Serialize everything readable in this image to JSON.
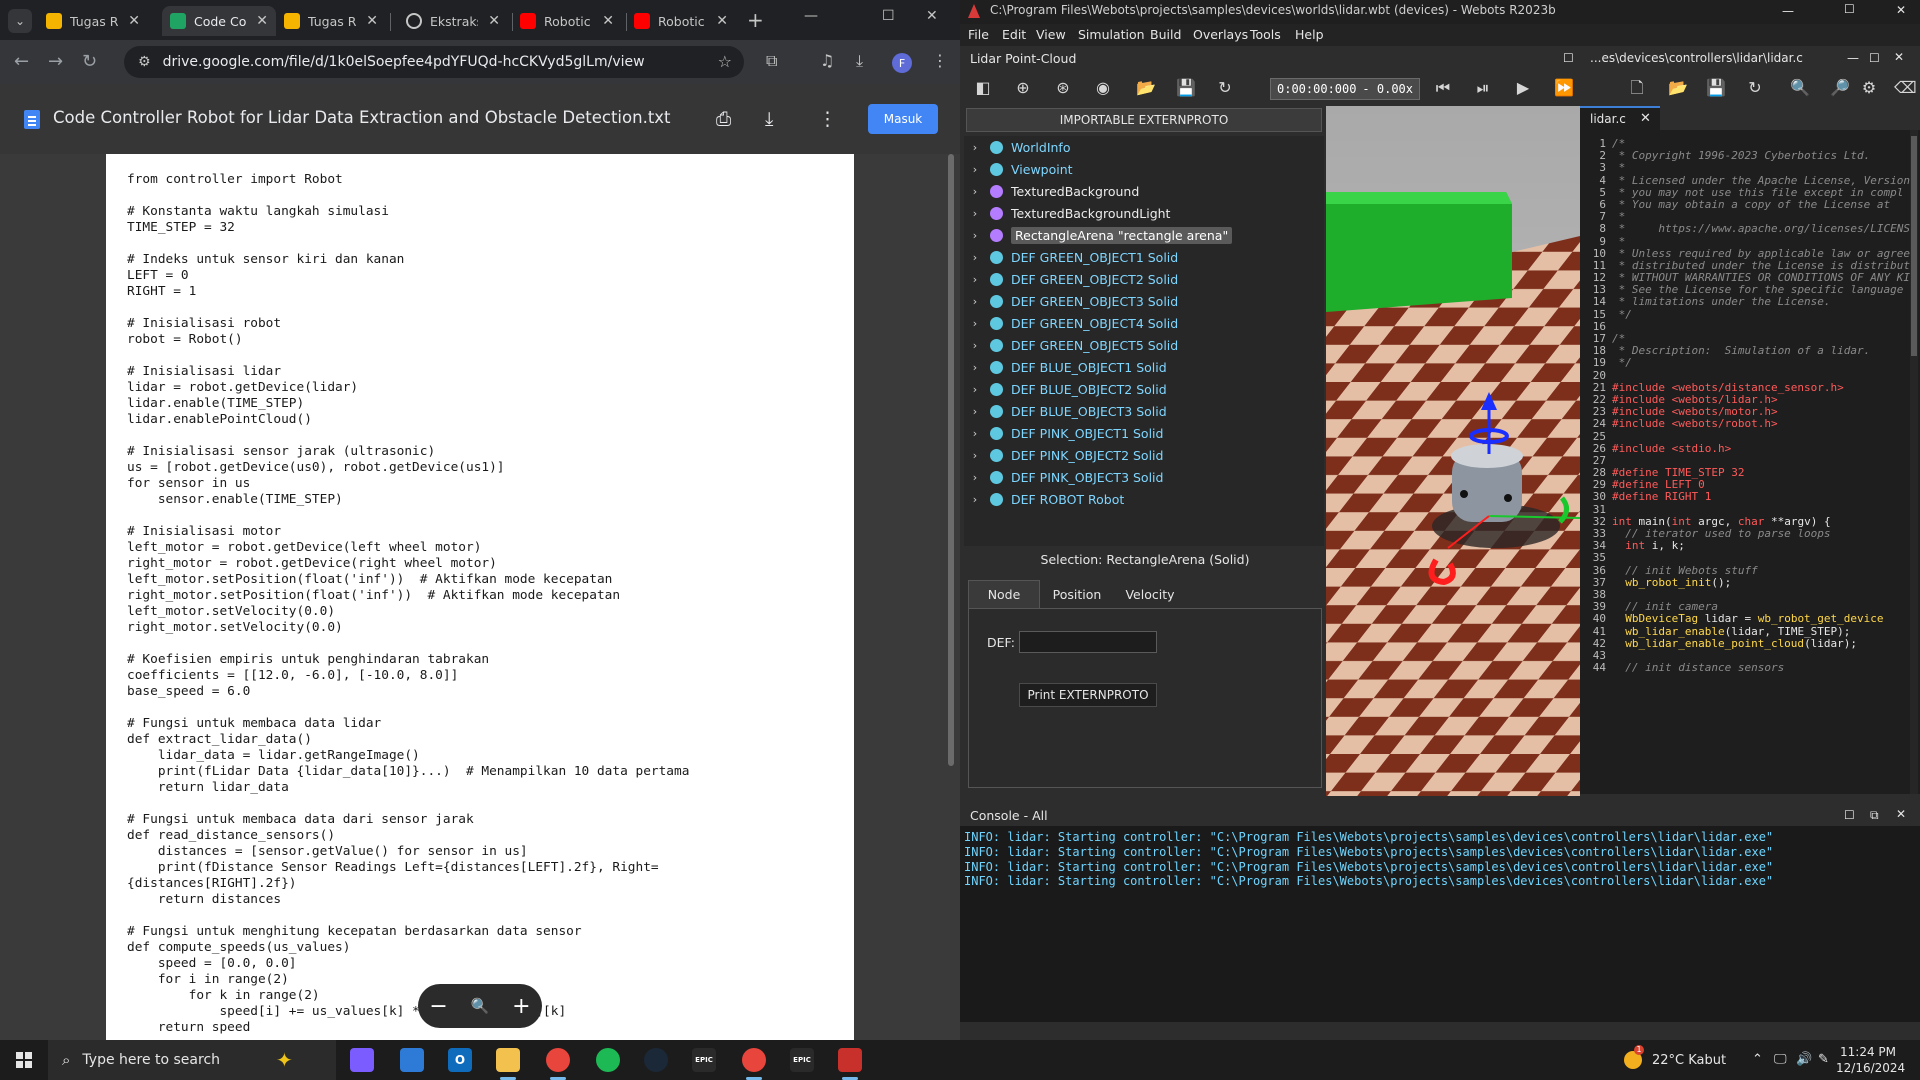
{
  "chrome": {
    "tabs": [
      {
        "title": "Tugas R",
        "icon": "google-slides-icon",
        "active": false
      },
      {
        "title": "Code Co",
        "icon": "google-drive-icon",
        "active": true
      },
      {
        "title": "Tugas R",
        "icon": "google-slides-icon",
        "active": false
      },
      {
        "title": "Ekstraksi",
        "icon": "openai-icon",
        "active": false
      },
      {
        "title": "Robotic",
        "icon": "youtube-icon",
        "active": false
      },
      {
        "title": "Robotic",
        "icon": "youtube-icon",
        "active": false
      }
    ],
    "url": "drive.google.com/file/d/1k0elSoepfee4pdYFUQd-hcCKVyd5glLm/view",
    "profile_initial": "F"
  },
  "drive": {
    "file_title": "Code Controller Robot for Lidar Data Extraction and Obstacle Detection.txt",
    "signin_label": "Masuk",
    "code_lines": [
      "from controller import Robot",
      "",
      "# Konstanta waktu langkah simulasi",
      "TIME_STEP = 32",
      "",
      "# Indeks untuk sensor kiri dan kanan",
      "LEFT = 0",
      "RIGHT = 1",
      "",
      "# Inisialisasi robot",
      "robot = Robot()",
      "",
      "# Inisialisasi lidar",
      "lidar = robot.getDevice(lidar)",
      "lidar.enable(TIME_STEP)",
      "lidar.enablePointCloud()",
      "",
      "# Inisialisasi sensor jarak (ultrasonic)",
      "us = [robot.getDevice(us0), robot.getDevice(us1)]",
      "for sensor in us",
      "    sensor.enable(TIME_STEP)",
      "",
      "# Inisialisasi motor",
      "left_motor = robot.getDevice(left wheel motor)",
      "right_motor = robot.getDevice(right wheel motor)",
      "left_motor.setPosition(float('inf'))  # Aktifkan mode kecepatan",
      "right_motor.setPosition(float('inf'))  # Aktifkan mode kecepatan",
      "left_motor.setVelocity(0.0)",
      "right_motor.setVelocity(0.0)",
      "",
      "# Koefisien empiris untuk penghindaran tabrakan",
      "coefficients = [[12.0, -6.0], [-10.0, 8.0]]",
      "base_speed = 6.0",
      "",
      "# Fungsi untuk membaca data lidar",
      "def extract_lidar_data()",
      "    lidar_data = lidar.getRangeImage()",
      "    print(fLidar Data {lidar_data[10]}...)  # Menampilkan 10 data pertama",
      "    return lidar_data",
      "",
      "# Fungsi untuk membaca data dari sensor jarak",
      "def read_distance_sensors()",
      "    distances = [sensor.getValue() for sensor in us]",
      "    print(fDistance Sensor Readings Left={distances[LEFT].2f}, Right=",
      "{distances[RIGHT].2f})",
      "    return distances",
      "",
      "# Fungsi untuk menghitung kecepatan berdasarkan data sensor",
      "def compute_speeds(us_values)",
      "    speed = [0.0, 0.0]",
      "    for i in range(2)",
      "        for k in range(2)",
      "            speed[i] += us_values[k] * coefficients[i][k]",
      "    return speed"
    ]
  },
  "webots": {
    "window_title": "C:\\Program Files\\Webots\\projects\\samples\\devices\\worlds\\lidar.wbt (devices) - Webots R2023b",
    "menu": [
      "File",
      "Edit",
      "View",
      "Simulation",
      "Build",
      "Overlays",
      "Tools",
      "Help"
    ],
    "scene_panel_title": "Lidar Point-Cloud",
    "sim_time": "0:00:00:000",
    "sim_speed": "- 0.00x",
    "extern_button": "IMPORTABLE EXTERNPROTO",
    "tree": [
      {
        "label": "WorldInfo",
        "color": "#5ec8e0",
        "style": "node"
      },
      {
        "label": "Viewpoint",
        "color": "#5ec8e0",
        "style": "node"
      },
      {
        "label": "TexturedBackground",
        "color": "#b47cff",
        "style": "proto"
      },
      {
        "label": "TexturedBackgroundLight",
        "color": "#b47cff",
        "style": "proto"
      },
      {
        "label": "RectangleArena \"rectangle arena\"",
        "color": "#b47cff",
        "style": "selected"
      },
      {
        "label": "DEF GREEN_OBJECT1 Solid",
        "color": "#5ec8e0",
        "style": "node"
      },
      {
        "label": "DEF GREEN_OBJECT2 Solid",
        "color": "#5ec8e0",
        "style": "node"
      },
      {
        "label": "DEF GREEN_OBJECT3 Solid",
        "color": "#5ec8e0",
        "style": "node"
      },
      {
        "label": "DEF GREEN_OBJECT4 Solid",
        "color": "#5ec8e0",
        "style": "node"
      },
      {
        "label": "DEF GREEN_OBJECT5 Solid",
        "color": "#5ec8e0",
        "style": "node"
      },
      {
        "label": "DEF BLUE_OBJECT1 Solid",
        "color": "#5ec8e0",
        "style": "node"
      },
      {
        "label": "DEF BLUE_OBJECT2 Solid",
        "color": "#5ec8e0",
        "style": "node"
      },
      {
        "label": "DEF BLUE_OBJECT3 Solid",
        "color": "#5ec8e0",
        "style": "node"
      },
      {
        "label": "DEF PINK_OBJECT1 Solid",
        "color": "#5ec8e0",
        "style": "node"
      },
      {
        "label": "DEF PINK_OBJECT2 Solid",
        "color": "#5ec8e0",
        "style": "node"
      },
      {
        "label": "DEF PINK_OBJECT3 Solid",
        "color": "#5ec8e0",
        "style": "node"
      },
      {
        "label": "DEF ROBOT Robot",
        "color": "#5ec8e0",
        "style": "node"
      }
    ],
    "selection": "Selection: RectangleArena (Solid)",
    "field_tabs": [
      "Node",
      "Position",
      "Velocity"
    ],
    "def_label": "DEF:",
    "def_value": "",
    "print_button": "Print EXTERNPROTO",
    "editor_path": "...es\\devices\\controllers\\lidar\\lidar.c",
    "editor_tab": "lidar.c",
    "editor_lines": [
      [
        [
          "c",
          "/*"
        ]
      ],
      [
        [
          "c",
          " * Copyright 1996-2023 Cyberbotics Ltd."
        ]
      ],
      [
        [
          "c",
          " *"
        ]
      ],
      [
        [
          "c",
          " * Licensed under the Apache License, Version"
        ]
      ],
      [
        [
          "c",
          " * you may not use this file except in compl"
        ]
      ],
      [
        [
          "c",
          " * You may obtain a copy of the License at"
        ]
      ],
      [
        [
          "c",
          " *"
        ]
      ],
      [
        [
          "c",
          " *     https://www.apache.org/licenses/LICENSE"
        ]
      ],
      [
        [
          "c",
          " *"
        ]
      ],
      [
        [
          "c",
          " * Unless required by applicable law or agree"
        ]
      ],
      [
        [
          "c",
          " * distributed under the License is distribut"
        ]
      ],
      [
        [
          "c",
          " * WITHOUT WARRANTIES OR CONDITIONS OF ANY KIN"
        ]
      ],
      [
        [
          "c",
          " * See the License for the specific language"
        ]
      ],
      [
        [
          "c",
          " * limitations under the License."
        ]
      ],
      [
        [
          "c",
          " */"
        ]
      ],
      [],
      [
        [
          "c",
          "/*"
        ]
      ],
      [
        [
          "c",
          " * Description:  Simulation of a lidar."
        ]
      ],
      [
        [
          "c",
          " */"
        ]
      ],
      [],
      [
        [
          "p",
          "#include <webots/distance_sensor.h>"
        ]
      ],
      [
        [
          "p",
          "#include <webots/lidar.h>"
        ]
      ],
      [
        [
          "p",
          "#include <webots/motor.h>"
        ]
      ],
      [
        [
          "p",
          "#include <webots/robot.h>"
        ]
      ],
      [],
      [
        [
          "p",
          "#include <stdio.h>"
        ]
      ],
      [],
      [
        [
          "p",
          "#define TIME_STEP 32"
        ]
      ],
      [
        [
          "p",
          "#define LEFT 0"
        ]
      ],
      [
        [
          "p",
          "#define RIGHT 1"
        ]
      ],
      [],
      [
        [
          "k",
          "int "
        ],
        [
          "t",
          "main("
        ],
        [
          "k",
          "int "
        ],
        [
          "t",
          "argc, "
        ],
        [
          "k",
          "char "
        ],
        [
          "t",
          "**argv) {"
        ]
      ],
      [
        [
          "c",
          "  // iterator used to parse loops"
        ]
      ],
      [
        [
          "k",
          "  int "
        ],
        [
          "t",
          "i, k;"
        ]
      ],
      [],
      [
        [
          "c",
          "  // init Webots stuff"
        ]
      ],
      [
        [
          "f",
          "  wb_robot_init"
        ],
        [
          "t",
          "();"
        ]
      ],
      [],
      [
        [
          "c",
          "  // init camera"
        ]
      ],
      [
        [
          "f",
          "  WbDeviceTag "
        ],
        [
          "t",
          "lidar = "
        ],
        [
          "f",
          "wb_robot_get_device"
        ]
      ],
      [
        [
          "f",
          "  wb_lidar_enable"
        ],
        [
          "t",
          "(lidar, TIME_STEP);"
        ]
      ],
      [
        [
          "f",
          "  wb_lidar_enable_point_cloud"
        ],
        [
          "t",
          "(lidar);"
        ]
      ],
      [],
      [
        [
          "c",
          "  // init distance sensors"
        ]
      ]
    ],
    "console_title": "Console - All",
    "console_lines": [
      "INFO: lidar: Starting controller: \"C:\\Program Files\\Webots\\projects\\samples\\devices\\controllers\\lidar\\lidar.exe\"",
      "INFO: lidar: Starting controller: \"C:\\Program Files\\Webots\\projects\\samples\\devices\\controllers\\lidar\\lidar.exe\"",
      "INFO: lidar: Starting controller: \"C:\\Program Files\\Webots\\projects\\samples\\devices\\controllers\\lidar\\lidar.exe\"",
      "INFO: lidar: Starting controller: \"C:\\Program Files\\Webots\\projects\\samples\\devices\\controllers\\lidar\\lidar.exe\""
    ]
  },
  "taskbar": {
    "search_placeholder": "Type here to search",
    "apps": [
      {
        "name": "copilot-icon",
        "color": "#7a5cff",
        "glyph": ""
      },
      {
        "name": "store-icon",
        "color": "#2d7bd6",
        "glyph": ""
      },
      {
        "name": "outlook-icon",
        "color": "#0f6cbd",
        "glyph": "O"
      },
      {
        "name": "file-explorer-icon",
        "color": "#f2c14e",
        "glyph": ""
      },
      {
        "name": "chrome-profile-icon",
        "color": "#e8453c",
        "glyph": ""
      },
      {
        "name": "spotify-icon",
        "color": "#1db954",
        "glyph": ""
      },
      {
        "name": "steam-icon",
        "color": "#1b2838",
        "glyph": ""
      },
      {
        "name": "epic-games-icon",
        "color": "#2a2a2a",
        "glyph": "EPIC"
      },
      {
        "name": "chrome-icon",
        "color": "#e8453c",
        "glyph": ""
      },
      {
        "name": "epic-games-icon",
        "color": "#2a2a2a",
        "glyph": "EPIC"
      },
      {
        "name": "webots-icon",
        "color": "#c8312b",
        "glyph": ""
      }
    ],
    "weather": "22°C  Kabut",
    "weather_badge": "1",
    "time": "11:24 PM",
    "date": "12/16/2024"
  }
}
